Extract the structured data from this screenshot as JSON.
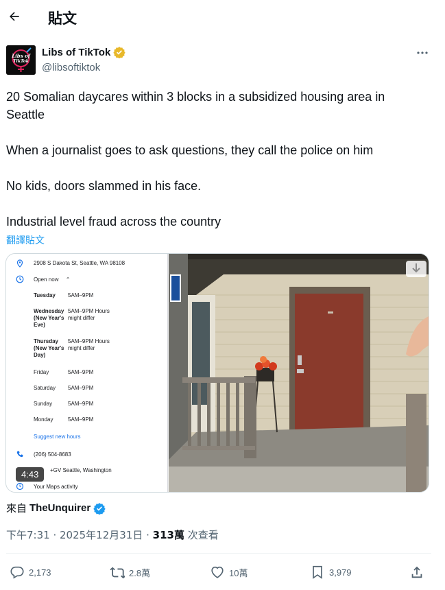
{
  "header": {
    "title": "貼文",
    "back_icon": "arrow-left-icon"
  },
  "author": {
    "name": "Libs of TikTok",
    "handle": "@libsoftiktok",
    "verified_badge": "gold-verified-badge-icon",
    "avatar_text": "Libs of TikTok",
    "more_icon": "more-horizontal-icon"
  },
  "tweet": {
    "paragraphs": [
      "20 Somalian daycares within 3 blocks in a subsidized housing area in Seattle",
      "When a journalist goes to ask questions, they call the police on him",
      "No kids, doors slammed in his face.",
      "Industrial level fraud across the country"
    ],
    "translate_label": "翻譯貼文"
  },
  "media": {
    "duration": "4:43",
    "map_panel": {
      "address": "2908 S Dakota St, Seattle, WA 98108",
      "open_status": "Open now",
      "hours": [
        {
          "day": "Tuesday",
          "hours": "5AM–9PM"
        },
        {
          "day": "Wednesday (New Year's Eve)",
          "hours": "5AM–9PM Hours might differ"
        },
        {
          "day": "Thursday (New Year's Day)",
          "hours": "5AM–9PM Hours might differ"
        },
        {
          "day": "Friday",
          "hours": "5AM–9PM"
        },
        {
          "day": "Saturday",
          "hours": "5AM–9PM"
        },
        {
          "day": "Sunday",
          "hours": "5AM–9PM"
        },
        {
          "day": "Monday",
          "hours": "5AM–9PM"
        }
      ],
      "suggest_hours": "Suggest new hours",
      "phone": "(206) 504-8683",
      "plus_code": "+GV Seattle, Washington",
      "activity": "Your Maps activity"
    },
    "house_number": "2908"
  },
  "source": {
    "prefix": "來自",
    "name": "TheUnquirer"
  },
  "meta": {
    "time_date": "下午7:31 · 2025年12月31日 · ",
    "views_count": "313萬",
    "views_label": " 次查看"
  },
  "actions": {
    "replies": "2,173",
    "reposts": "2.8萬",
    "likes": "10萬",
    "bookmarks": "3,979"
  },
  "colors": {
    "accent": "#1d9bf0",
    "muted": "#536471",
    "gold": "#e8b82a",
    "door": "#8a3a2c"
  }
}
